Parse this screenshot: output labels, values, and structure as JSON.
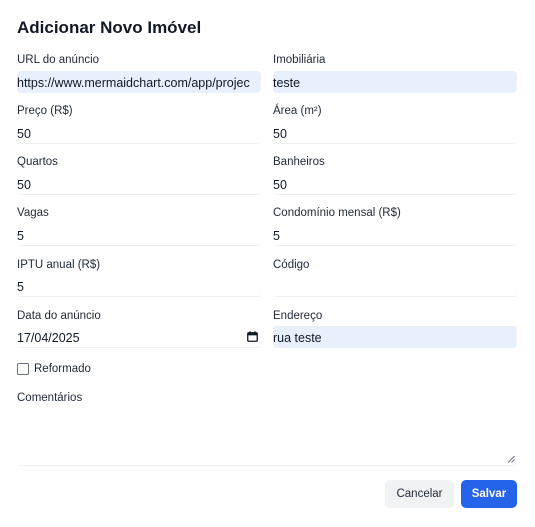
{
  "dialog": {
    "title": "Adicionar Novo Imóvel"
  },
  "fields": {
    "url": {
      "label": "URL do anúncio",
      "value": "https://www.mermaidchart.com/app/projec"
    },
    "imobiliaria": {
      "label": "Imobiliária",
      "value": "teste"
    },
    "preco": {
      "label": "Preço (R$)",
      "value": "50"
    },
    "area": {
      "label": "Área (m²)",
      "value": "50"
    },
    "quartos": {
      "label": "Quartos",
      "value": "50"
    },
    "banheiros": {
      "label": "Banheiros",
      "value": "50"
    },
    "vagas": {
      "label": "Vagas",
      "value": "5"
    },
    "condominio": {
      "label": "Condomínio mensal (R$)",
      "value": "5"
    },
    "iptu": {
      "label": "IPTU anual (R$)",
      "value": "5"
    },
    "codigo": {
      "label": "Código",
      "value": ""
    },
    "data": {
      "label": "Data do anúncio",
      "value": "17/04/2025"
    },
    "endereco": {
      "label": "Endereço",
      "value": "rua teste"
    },
    "reformado": {
      "label": "Reformado",
      "checked": false
    },
    "comentarios": {
      "label": "Comentários",
      "value": ""
    }
  },
  "buttons": {
    "cancel": "Cancelar",
    "save": "Salvar"
  },
  "colors": {
    "primary": "#2563eb",
    "autofill": "#e8f0fe"
  },
  "icons": {
    "date_picker": "calendar-icon",
    "resize": "resize-grip-icon"
  }
}
